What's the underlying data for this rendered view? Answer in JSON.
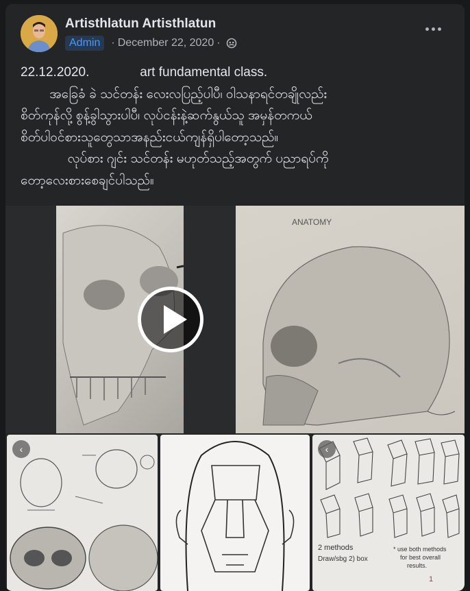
{
  "post": {
    "author": "Artisthlatun Artisthlatun",
    "role_badge": "Admin",
    "date": "December 22, 2020",
    "separator": "·",
    "privacy_icon": "friends-icon",
    "more_icon": "more-options-icon",
    "text_lines": [
      "22.12.2020.              art fundamental class.",
      "        အခြေခံ ခဲ သင်တန်း လေးလပြည့်ပါပီ၊ ဝါသနာရင်တချိုလည်း",
      "စိတ်ကုန်လို့ စွန့်ခွါသွားပါပီ၊ လုပ်ငန်းနဲ့ဆက်နွယ်သူ အမှန်တကယ်",
      "စိတ်ပါဝင်စားသူတွေသာအနည်းငယ်ကျန်ရှိပါတော့သည်။",
      "             လုပ်စား ဂျင်း သင်တန်း မဟုတ်သည့်အတွက် ပညာရပ်ကို",
      "တော့လေးစားစေချင်ပါသည်။"
    ]
  },
  "media": {
    "video_play_icon": "play-icon",
    "sketch_b_label": "ANATOMY",
    "thumb3_labels": [
      "2 methods",
      "Draw/sbg 2) box",
      "* use both methods",
      "for best overall",
      "results."
    ]
  },
  "colors": {
    "card_bg": "#242526",
    "badge_bg": "#263951",
    "badge_text": "#4599ff",
    "secondary_text": "#b0b3b8"
  }
}
